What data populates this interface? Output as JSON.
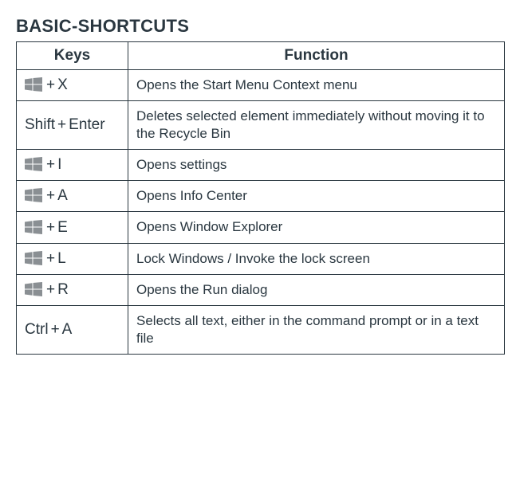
{
  "title": "BASIC-SHORTCUTS",
  "headers": {
    "keys": "Keys",
    "function": "Function"
  },
  "winIconColor": "#8a8f93",
  "rows": [
    {
      "parts": [
        {
          "t": "win"
        },
        {
          "t": "plus"
        },
        {
          "t": "txt",
          "v": "X"
        }
      ],
      "func": "Opens the Start Menu Context menu"
    },
    {
      "parts": [
        {
          "t": "txt",
          "v": "Shift"
        },
        {
          "t": "plus"
        },
        {
          "t": "txt",
          "v": "Enter"
        }
      ],
      "func": "Deletes selected element immediately without mo­ving it to the Recycle Bin"
    },
    {
      "parts": [
        {
          "t": "win"
        },
        {
          "t": "plus"
        },
        {
          "t": "txt",
          "v": "I"
        }
      ],
      "func": "Opens settings"
    },
    {
      "parts": [
        {
          "t": "win"
        },
        {
          "t": "plus"
        },
        {
          "t": "txt",
          "v": "A"
        }
      ],
      "func": "Opens Info Center"
    },
    {
      "parts": [
        {
          "t": "win"
        },
        {
          "t": "plus"
        },
        {
          "t": "txt",
          "v": "E"
        }
      ],
      "func": "Opens Window Explorer"
    },
    {
      "parts": [
        {
          "t": "win"
        },
        {
          "t": "plus"
        },
        {
          "t": "txt",
          "v": "L"
        }
      ],
      "func": "Lock Windows  /  Invoke the lock screen"
    },
    {
      "parts": [
        {
          "t": "win"
        },
        {
          "t": "plus"
        },
        {
          "t": "txt",
          "v": "R"
        }
      ],
      "func": "Opens the Run dialog"
    },
    {
      "parts": [
        {
          "t": "txt",
          "v": "Ctrl"
        },
        {
          "t": "plus"
        },
        {
          "t": "txt",
          "v": "A"
        }
      ],
      "func": "Selects all text, either in the command prompt or in a text file"
    }
  ]
}
